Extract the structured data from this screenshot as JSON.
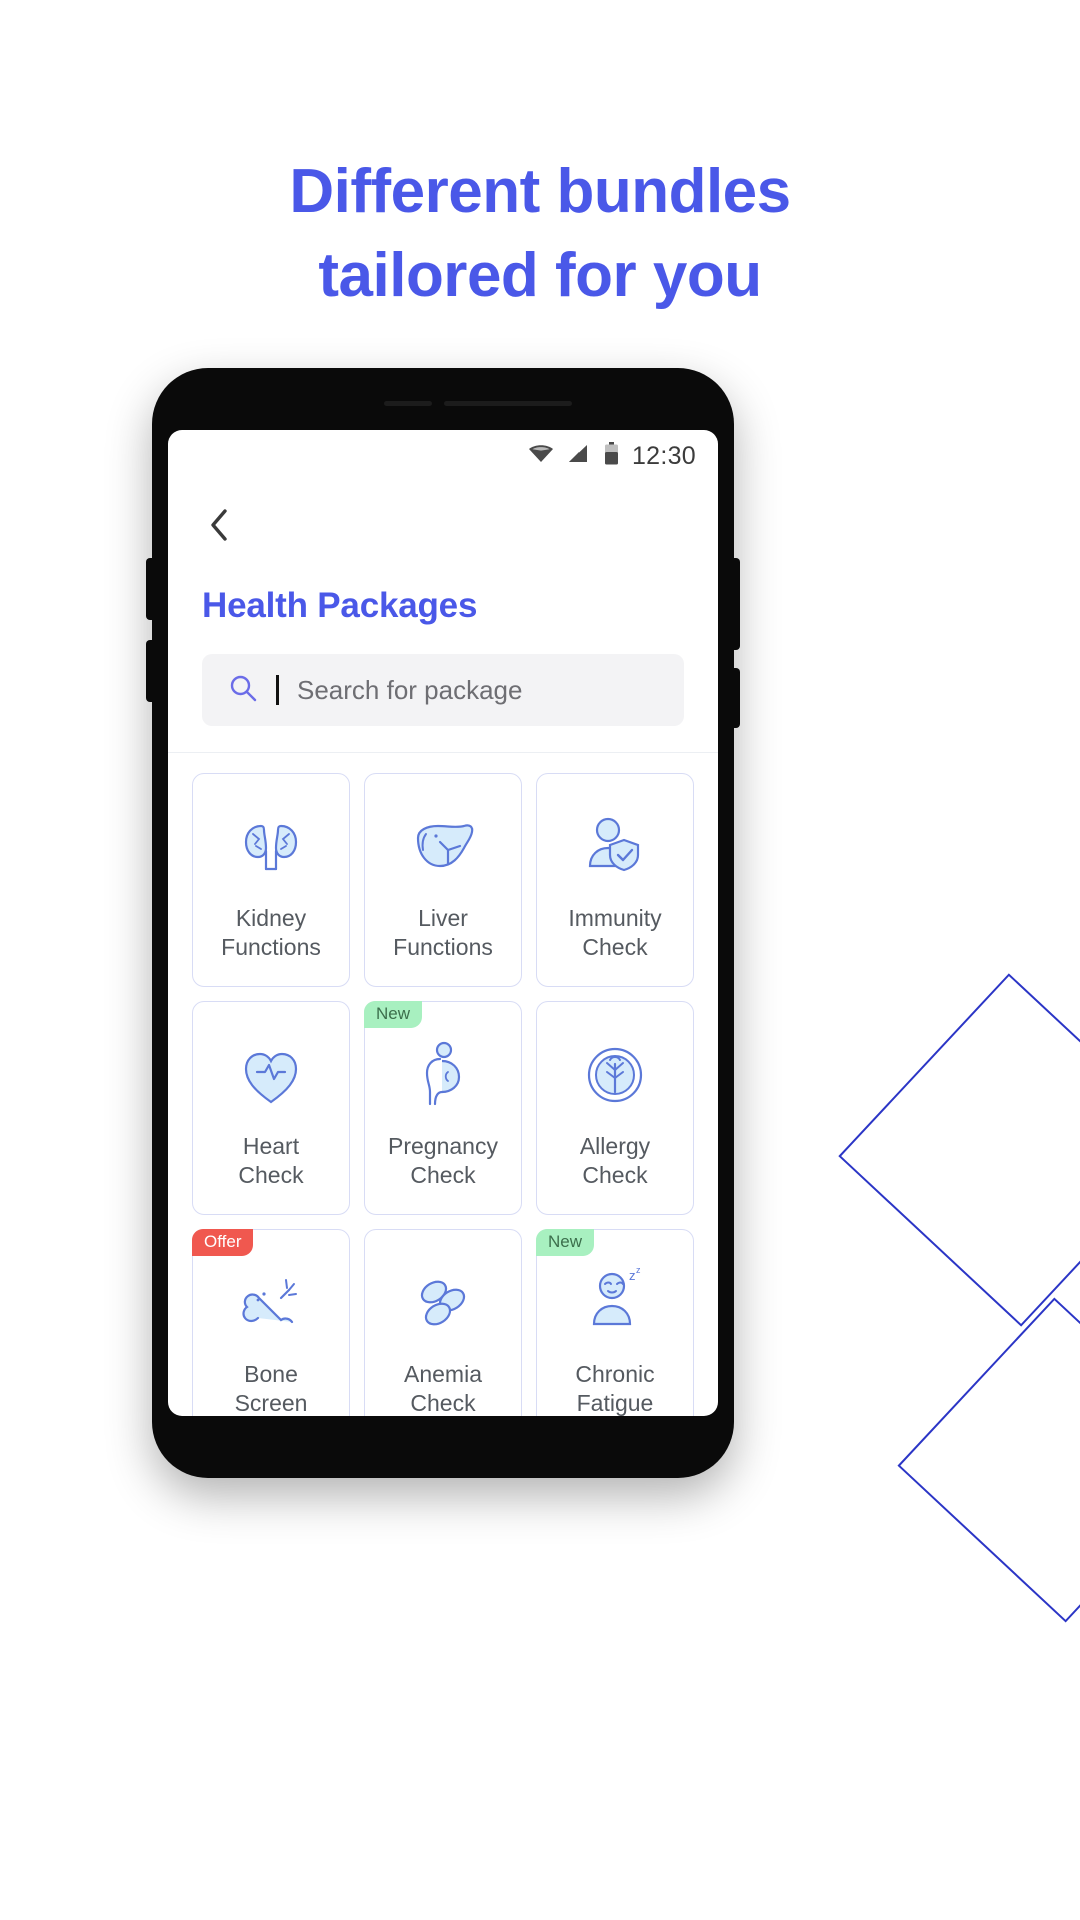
{
  "headline": {
    "line1": "Different bundles",
    "line2": "tailored for you",
    "color": "#4a58e8"
  },
  "phone": {
    "status_bar": {
      "wifi_icon": "wifi-icon",
      "signal_icon": "cellular-signal-icon",
      "battery_icon": "battery-icon",
      "time": "12:30"
    },
    "app": {
      "back_icon": "chevron-left-icon",
      "title": "Health Packages",
      "title_color": "#4a58e8",
      "search": {
        "icon": "search-icon",
        "placeholder": "Search for package",
        "value": ""
      },
      "packages": [
        {
          "label_line1": "Kidney",
          "label_line2": "Functions",
          "icon": "kidney-icon",
          "badge": null
        },
        {
          "label_line1": "Liver",
          "label_line2": "Functions",
          "icon": "liver-icon",
          "badge": null
        },
        {
          "label_line1": "Immunity",
          "label_line2": "Check",
          "icon": "immunity-icon",
          "badge": null
        },
        {
          "label_line1": "Heart",
          "label_line2": "Check",
          "icon": "heart-icon",
          "badge": null
        },
        {
          "label_line1": "Pregnancy",
          "label_line2": "Check",
          "icon": "pregnancy-icon",
          "badge": "New"
        },
        {
          "label_line1": "Allergy",
          "label_line2": "Check",
          "icon": "allergy-icon",
          "badge": null
        },
        {
          "label_line1": "Bone",
          "label_line2": "Screen",
          "icon": "bone-icon",
          "badge": "Offer"
        },
        {
          "label_line1": "Anemia",
          "label_line2": "Check",
          "icon": "anemia-blood-cell-icon",
          "badge": null
        },
        {
          "label_line1": "Chronic",
          "label_line2": "Fatigue",
          "icon": "chronic-fatigue-icon",
          "badge": "New"
        },
        {
          "label_line1": "",
          "label_line2": "",
          "icon": "dna-icon",
          "badge": null
        },
        {
          "label_line1": "",
          "label_line2": "",
          "icon": "baby-icon",
          "badge": null
        },
        {
          "label_line1": "",
          "label_line2": "",
          "icon": "blood-pressure-icon",
          "badge": null
        }
      ],
      "badge_colors": {
        "new": "#a8f0c0",
        "offer": "#f0584f"
      }
    }
  }
}
